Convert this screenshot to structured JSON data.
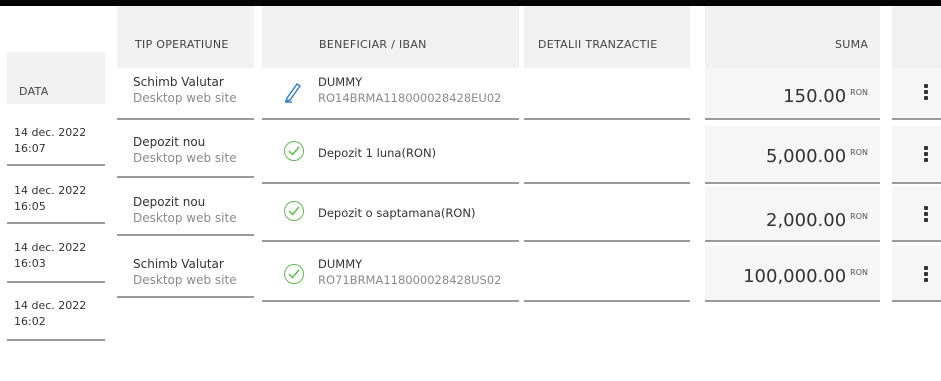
{
  "headers": {
    "date": "DATA",
    "operation": "TIP OPERATIUNE",
    "beneficiary": "BENEFICIAR / IBAN",
    "details": "DETALII TRANZACTIE",
    "amount": "SUMA"
  },
  "dates": [
    {
      "day": "14 dec. 2022",
      "time": "16:07"
    },
    {
      "day": "14 dec. 2022",
      "time": "16:05"
    },
    {
      "day": "14 dec. 2022",
      "time": "16:03"
    },
    {
      "day": "14 dec. 2022",
      "time": "16:02"
    }
  ],
  "rows": [
    {
      "op_title": "Schimb Valutar",
      "op_sub": "Desktop web site",
      "ben_name": "DUMMY",
      "ben_iban": "RO14BRMA118000028428EU02",
      "icon": "pencil-icon",
      "amount": "150.00",
      "currency": "RON"
    },
    {
      "op_title": "Depozit nou",
      "op_sub": "Desktop web site",
      "ben_name": "Depozit 1 luna(RON)",
      "ben_iban": "",
      "icon": "check-circle-icon",
      "amount": "5,000.00",
      "currency": "RON"
    },
    {
      "op_title": "Depozit nou",
      "op_sub": "Desktop web site",
      "ben_name": "Depozit o saptamana(RON)",
      "ben_iban": "",
      "icon": "check-circle-icon",
      "amount": "2,000.00",
      "currency": "RON"
    },
    {
      "op_title": "Schimb Valutar",
      "op_sub": "Desktop web site",
      "ben_name": "DUMMY",
      "ben_iban": "RO71BRMA118000028428US02",
      "icon": "check-circle-icon",
      "amount": "100,000.00",
      "currency": "RON"
    }
  ],
  "colors": {
    "check": "#5bbf4a",
    "pencil": "#2f7fd0",
    "panel": "#f1f1f2"
  }
}
